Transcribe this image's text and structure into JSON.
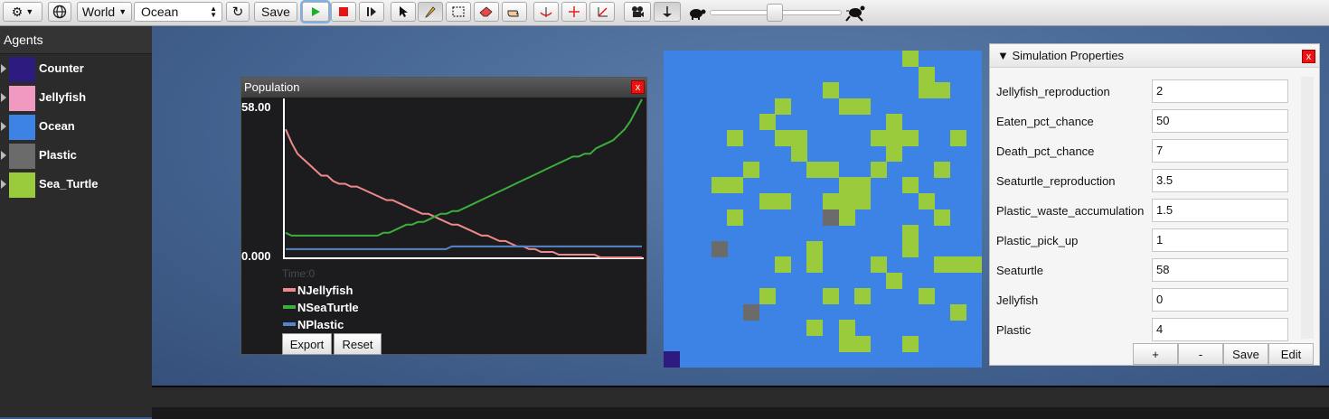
{
  "toolbar": {
    "settings_icon": "gear-icon",
    "globe_icon": "globe-icon",
    "world_label": "World",
    "ocean_value": "Ocean",
    "save_label": "Save",
    "tools": [
      "play-icon",
      "stop-icon",
      "step-icon",
      "select-arrow-icon",
      "pencil-icon",
      "marquee-icon",
      "eraser-icon",
      "hand-icon",
      "rotate-icon",
      "move-icon",
      "scale-icon",
      "camera-icon",
      "agent-view-icon",
      "slow-turtle-icon",
      "fast-turtle-icon"
    ],
    "speed_fraction": 0.5,
    "colors": {
      "play": "#1fae2a",
      "stop": "#e41414"
    }
  },
  "agents": {
    "header": "Agents",
    "items": [
      {
        "name": "Counter",
        "color": "#2e1b80"
      },
      {
        "name": "Jellyfish",
        "color": "#f19ac1"
      },
      {
        "name": "Ocean",
        "color": "#3d83e6"
      },
      {
        "name": "Plastic",
        "color": "#6b6b6b"
      },
      {
        "name": "Sea_Turtle",
        "color": "#9acb3c"
      }
    ]
  },
  "population": {
    "title": "Population",
    "close": "x",
    "y_max_label": "58.00",
    "y_min_label": "0.000",
    "time_label": "Time:0",
    "export_label": "Export",
    "reset_label": "Reset",
    "chart_data": {
      "type": "line",
      "ylim": [
        0,
        58
      ],
      "grid": false,
      "legend": "bottom-left",
      "series": [
        {
          "name": "NJellyfish",
          "color": "#f08a8a",
          "values": [
            47,
            42,
            38,
            36,
            34,
            32,
            30,
            30,
            28,
            27,
            27,
            26,
            26,
            25,
            24,
            23,
            22,
            21,
            21,
            20,
            19,
            18,
            17,
            16,
            16,
            15,
            14,
            13,
            12,
            12,
            11,
            10,
            9,
            8,
            8,
            7,
            6,
            6,
            5,
            4,
            4,
            3,
            3,
            2,
            2,
            2,
            1,
            1,
            1,
            1,
            1,
            1,
            1,
            0,
            0,
            0,
            0,
            0,
            0,
            0,
            0
          ]
        },
        {
          "name": "NSeaTurtle",
          "color": "#3cae3c",
          "values": [
            9,
            8,
            8,
            8,
            8,
            8,
            8,
            8,
            8,
            8,
            8,
            8,
            8,
            8,
            8,
            8,
            8,
            9,
            9,
            10,
            11,
            12,
            12,
            13,
            13,
            14,
            15,
            16,
            16,
            17,
            17,
            18,
            19,
            20,
            21,
            22,
            23,
            24,
            25,
            26,
            27,
            28,
            29,
            30,
            31,
            32,
            33,
            34,
            35,
            36,
            37,
            37,
            38,
            38,
            40,
            41,
            42,
            43,
            45,
            47,
            50,
            54,
            58
          ]
        },
        {
          "name": "NPlastic",
          "color": "#5585c9",
          "values": [
            3,
            3,
            3,
            3,
            3,
            3,
            3,
            3,
            3,
            3,
            3,
            3,
            3,
            3,
            3,
            3,
            3,
            3,
            3,
            3,
            3,
            3,
            3,
            3,
            3,
            3,
            3,
            3,
            4,
            4,
            4,
            4,
            4,
            4,
            4,
            4,
            4,
            4,
            4,
            4,
            4,
            4,
            4,
            4,
            4,
            4,
            4,
            4,
            4,
            4,
            4,
            4,
            4,
            4,
            4,
            4,
            4,
            4,
            4,
            4,
            4
          ]
        }
      ]
    }
  },
  "world": {
    "colors": {
      "ocean": "#3d83e6",
      "turtle": "#9acb3c",
      "plastic": "#6b6b6b",
      "counter": "#2e1b80"
    },
    "turtles": [
      [
        15,
        0
      ],
      [
        16,
        1
      ],
      [
        16,
        2
      ],
      [
        17,
        2
      ],
      [
        10,
        2
      ],
      [
        7,
        3
      ],
      [
        11,
        3
      ],
      [
        12,
        3
      ],
      [
        6,
        4
      ],
      [
        14,
        4
      ],
      [
        4,
        5
      ],
      [
        7,
        5
      ],
      [
        8,
        5
      ],
      [
        13,
        5
      ],
      [
        14,
        5
      ],
      [
        15,
        5
      ],
      [
        18,
        5
      ],
      [
        8,
        6
      ],
      [
        14,
        6
      ],
      [
        5,
        7
      ],
      [
        9,
        7
      ],
      [
        10,
        7
      ],
      [
        13,
        7
      ],
      [
        17,
        7
      ],
      [
        3,
        8
      ],
      [
        4,
        8
      ],
      [
        11,
        8
      ],
      [
        12,
        8
      ],
      [
        15,
        8
      ],
      [
        6,
        9
      ],
      [
        7,
        9
      ],
      [
        10,
        9
      ],
      [
        11,
        9
      ],
      [
        12,
        9
      ],
      [
        16,
        9
      ],
      [
        4,
        10
      ],
      [
        11,
        10
      ],
      [
        17,
        10
      ],
      [
        15,
        11
      ],
      [
        9,
        12
      ],
      [
        15,
        12
      ],
      [
        7,
        13
      ],
      [
        9,
        13
      ],
      [
        13,
        13
      ],
      [
        17,
        13
      ],
      [
        18,
        13
      ],
      [
        19,
        13
      ],
      [
        14,
        14
      ],
      [
        6,
        15
      ],
      [
        10,
        15
      ],
      [
        12,
        15
      ],
      [
        16,
        15
      ],
      [
        18,
        16
      ],
      [
        9,
        17
      ],
      [
        11,
        17
      ],
      [
        11,
        18
      ],
      [
        12,
        18
      ],
      [
        15,
        18
      ]
    ],
    "plastic": [
      [
        10,
        10
      ],
      [
        3,
        12
      ],
      [
        5,
        16
      ]
    ],
    "counter": [
      [
        0,
        19
      ]
    ]
  },
  "properties": {
    "title": "Simulation Properties",
    "close": "x",
    "items": [
      {
        "label": "Jellyfish_reproduction",
        "value": "2"
      },
      {
        "label": "Eaten_pct_chance",
        "value": "50"
      },
      {
        "label": "Death_pct_chance",
        "value": "7"
      },
      {
        "label": "Seaturtle_reproduction",
        "value": "3.5"
      },
      {
        "label": "Plastic_waste_accumulation",
        "value": "1.5"
      },
      {
        "label": "Plastic_pick_up",
        "value": "1"
      },
      {
        "label": "Seaturtle",
        "value": "58"
      },
      {
        "label": "Jellyfish",
        "value": "0"
      },
      {
        "label": "Plastic",
        "value": "4"
      }
    ],
    "buttons": {
      "add": "+",
      "remove": "-",
      "save": "Save",
      "edit": "Edit"
    }
  }
}
